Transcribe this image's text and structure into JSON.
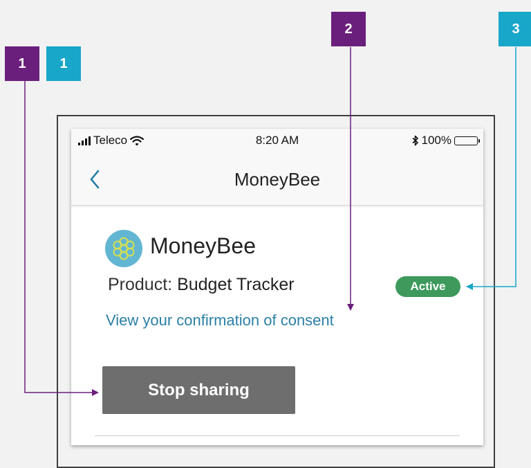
{
  "markers": [
    {
      "label": "1",
      "color": "#6b1f7c"
    },
    {
      "label": "1",
      "color": "#18a6c9"
    },
    {
      "label": "2",
      "color": "#6b1f7c"
    },
    {
      "label": "3",
      "color": "#18a6c9"
    }
  ],
  "status_bar": {
    "carrier": "Teleco",
    "time": "8:20 AM",
    "battery": "100%"
  },
  "nav": {
    "title": "MoneyBee",
    "back_icon": "chevron-left-icon"
  },
  "app": {
    "name": "MoneyBee",
    "logo_icon": "honeycomb-logo"
  },
  "product": {
    "label": "Product:",
    "name": "Budget Tracker"
  },
  "status_badge": {
    "text": "Active",
    "color": "#3d9a5c"
  },
  "consent_link": "View your confirmation of consent",
  "stop_button": "Stop sharing",
  "colors": {
    "link": "#2a7fa6",
    "annotation_purple": "#6b1f7c",
    "annotation_teal": "#18a6c9",
    "button_bg": "#6e6e6e"
  }
}
